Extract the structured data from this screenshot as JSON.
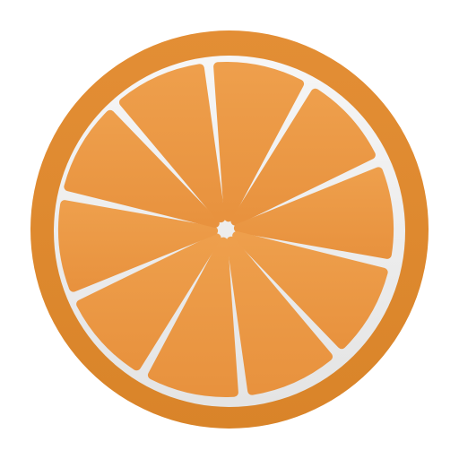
{
  "icon": {
    "name": "orange-slice-icon",
    "colors": {
      "peel": "#e38e35",
      "peel_shadow": "#d98429",
      "pith": "#f6f6f6",
      "pith_shadow": "#e4e4e4",
      "segment_top": "#ee9f4c",
      "segment_bottom": "#e8923e"
    },
    "segment_count": 10
  }
}
